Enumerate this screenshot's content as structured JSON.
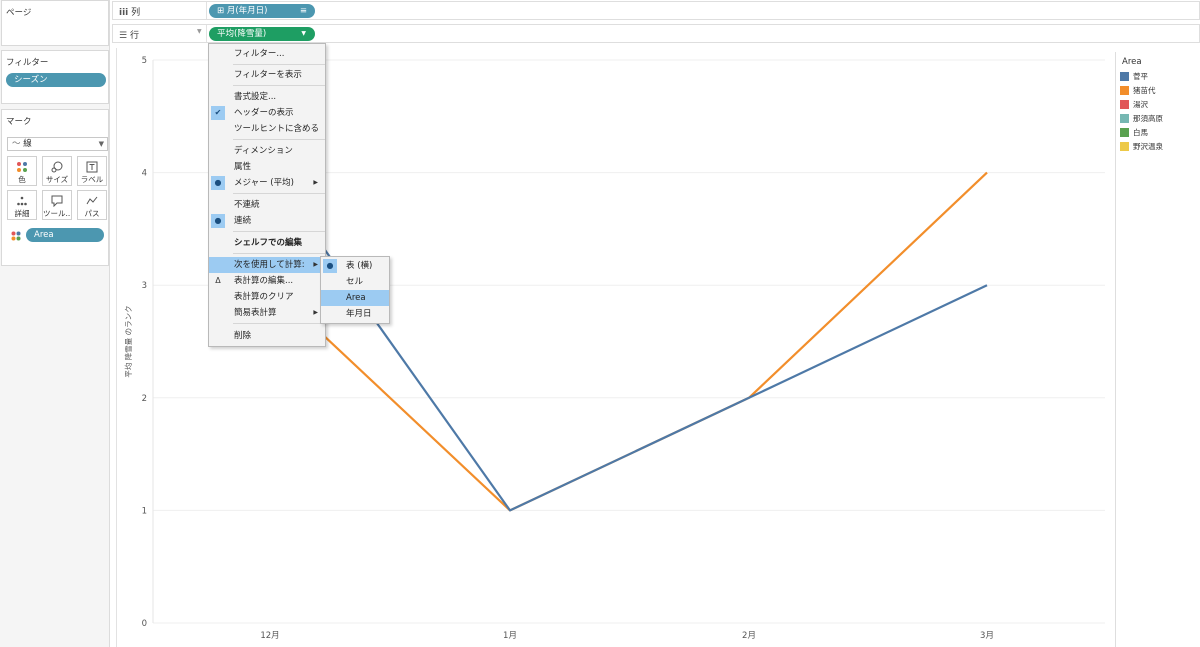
{
  "pages": {
    "title": "ページ"
  },
  "filters": {
    "title": "フィルター",
    "items": [
      "シーズン"
    ]
  },
  "marks": {
    "title": "マーク",
    "mark_type": "線",
    "buttons": [
      {
        "label": "色",
        "icon": "color-icon"
      },
      {
        "label": "サイズ",
        "icon": "size-icon"
      },
      {
        "label": "ラベル",
        "icon": "label-icon"
      },
      {
        "label": "詳細",
        "icon": "detail-icon"
      },
      {
        "label": "ツール...",
        "icon": "tooltip-icon"
      },
      {
        "label": "パス",
        "icon": "path-icon"
      }
    ],
    "color_field": "Area"
  },
  "shelves": {
    "columns": {
      "label": "列",
      "pill": "⊞ 月(年月日)"
    },
    "rows": {
      "label": "行",
      "pill": "平均(降雪量)"
    }
  },
  "context_menu": {
    "items": [
      "フィルター...",
      "フィルターを表示",
      "書式設定...",
      "ヘッダーの表示",
      "ツールヒントに含める",
      "ディメンション",
      "属性",
      "メジャー (平均)",
      "不連続",
      "連続",
      "シェルフでの編集",
      "次を使用して計算:",
      "表計算の編集...",
      "表計算のクリア",
      "簡易表計算",
      "削除"
    ],
    "delta_glyph": "Δ",
    "submenu": [
      "表 (横)",
      "セル",
      "Area",
      "年月日"
    ]
  },
  "legend": {
    "title": "Area",
    "items": [
      {
        "label": "菅平",
        "color": "#4e79a7"
      },
      {
        "label": "猪苗代",
        "color": "#f28e2b"
      },
      {
        "label": "湯沢",
        "color": "#e15759"
      },
      {
        "label": "那須高原",
        "color": "#76b7b2"
      },
      {
        "label": "白馬",
        "color": "#59a14f"
      },
      {
        "label": "野沢温泉",
        "color": "#edc948"
      }
    ]
  },
  "chart_data": {
    "type": "line",
    "categories": [
      "12月",
      "1月",
      "2月",
      "3月"
    ],
    "ylabel": "平均 降雪量 のランク",
    "ylim": [
      0,
      5
    ],
    "yticks": [
      "0",
      "1",
      "2",
      "3",
      "4",
      "5"
    ],
    "grid": true,
    "series": [
      {
        "name": "菅平",
        "color": "#4e79a7",
        "values": [
          4,
          1,
          2,
          3
        ]
      },
      {
        "name": "猪苗代",
        "color": "#f28e2b",
        "values": [
          3,
          1,
          2,
          4
        ]
      }
    ]
  }
}
